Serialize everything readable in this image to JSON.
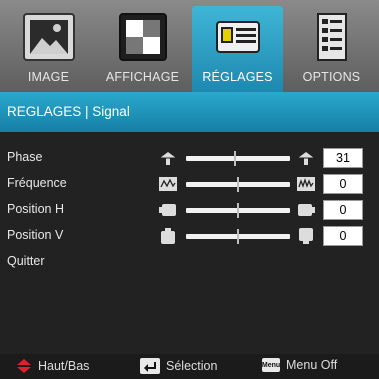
{
  "tabs": [
    {
      "label": "IMAGE",
      "icon": "image-icon",
      "active": false
    },
    {
      "label": "AFFICHAGE",
      "icon": "display-icon",
      "active": false
    },
    {
      "label": "RÉGLAGES",
      "icon": "projector-icon",
      "active": true
    },
    {
      "label": "OPTIONS",
      "icon": "options-icon",
      "active": false
    }
  ],
  "header": {
    "title": "REGLAGES | Signal"
  },
  "rows": [
    {
      "label": "Phase",
      "value": "31",
      "level": 0.47
    },
    {
      "label": "Fréquence",
      "value": "0",
      "level": 0.5
    },
    {
      "label": "Position H",
      "value": "0",
      "level": 0.5
    },
    {
      "label": "Position V",
      "value": "0",
      "level": 0.5
    },
    {
      "label": "Quitter"
    }
  ],
  "footer": {
    "nav_label": "Haut/Bas",
    "select_label": "Sélection",
    "menu_key": "Menu",
    "menu_label": "Menu Off"
  },
  "colors": {
    "accent": "#1e88b0",
    "tab_bg": "#6f6f6f",
    "content_bg": "#222222",
    "nav_arrow": "#e0202a"
  }
}
